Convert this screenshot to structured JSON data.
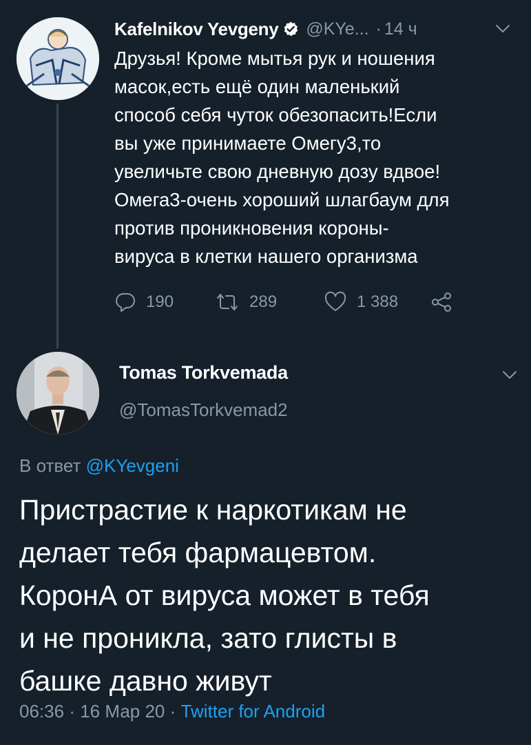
{
  "parent_tweet": {
    "author_name": "Kafelnikov Yevgeny",
    "handle": "@KYe...",
    "separator": "·",
    "time": "14 ч",
    "body_lines": [
      "Друзья! Кроме мытья рук и ношения",
      "масок,есть ещё один маленький",
      "способ себя чуток обезопасить!Если",
      "вы уже принимаете Омегу3,то",
      "увеличьте свою дневную дозу вдвое!",
      "Омега3-очень хороший шлагбаум для",
      "против проникновения короны-",
      "вируса в клетки нашего организма"
    ],
    "replies_count": "190",
    "retweets_count": "289",
    "likes_count": "1 388"
  },
  "reply_tweet": {
    "author_name": "Tomas Torkvemada",
    "handle": "@TomasTorkvemad2",
    "reply_prefix": "В ответ",
    "reply_mention": "@KYevgeni",
    "body_lines": [
      "Пристрастие к наркотикам не",
      "делает тебя фармацевтом.",
      "КоронА от вируса может в тебя",
      "и не проникла, зато глисты в",
      "башке давно живут"
    ],
    "time": "06:36",
    "date": "16 Мар 20",
    "separator": "·",
    "source": "Twitter for Android"
  },
  "colors": {
    "background": "#15202b",
    "text_primary": "#ffffff",
    "text_secondary": "#8899a6",
    "accent": "#1da1f2",
    "thread_line": "#38444d"
  },
  "icons": [
    "verified-badge-icon",
    "chevron-down-icon",
    "reply-icon",
    "retweet-icon",
    "like-icon",
    "share-icon"
  ]
}
